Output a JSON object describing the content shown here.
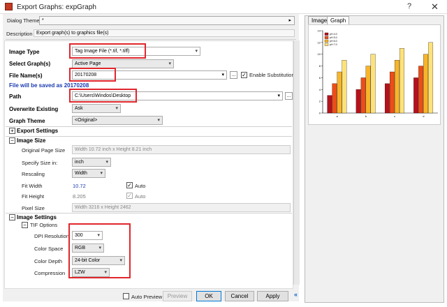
{
  "window": {
    "title": "Export Graphs: expGraph",
    "help": "?",
    "close": "✕"
  },
  "dialog_theme": {
    "label": "Dialog Theme",
    "value": "*",
    "arrow": "▸"
  },
  "description": {
    "label": "Description",
    "value": "Export graph(s) to graphics file(s)"
  },
  "form": {
    "image_type": {
      "label": "Image Type",
      "value": "Tag Image File (*.tif, *.tiff)"
    },
    "select_graphs": {
      "label": "Select Graph(s)",
      "value": "Active Page"
    },
    "file_name": {
      "label": "File Name(s)",
      "value": "20170208",
      "button": "...",
      "enable_substitution": "Enable Substitution",
      "enable_substitution_checked": true
    },
    "saved_as": "File will be saved as 20170208",
    "path": {
      "label": "Path",
      "value": "C:\\Users\\Windos\\Desktop",
      "button": "..."
    },
    "overwrite": {
      "label": "Overwrite Existing",
      "value": "Ask"
    },
    "graph_theme": {
      "label": "Graph Theme",
      "value": "<Original>"
    },
    "export_settings": {
      "label": "Export Settings",
      "toggle": "+"
    },
    "image_size": {
      "label": "Image Size",
      "toggle": "−",
      "original_page_size": {
        "label": "Original Page Size",
        "value": "Width 10.72 inch x Height 8.21 inch"
      },
      "specify_size_in": {
        "label": "Specify Size in:",
        "value": "inch"
      },
      "rescaling": {
        "label": "Rescaling",
        "value": "Width"
      },
      "fit_width": {
        "label": "Fit Width",
        "value": "10.72",
        "auto": "Auto",
        "auto_checked": true
      },
      "fit_height": {
        "label": "Fit Height",
        "value": "8.205",
        "auto": "Auto",
        "auto_checked": true
      },
      "pixel_size": {
        "label": "Pixel Size",
        "value": "Width 3216 x Height 2462"
      }
    },
    "image_settings": {
      "label": "Image Settings",
      "toggle": "−",
      "tif_options": {
        "label": "TIF Options",
        "toggle": "−"
      },
      "dpi_resolution": {
        "label": "DPI Resolution",
        "value": "300"
      },
      "color_space": {
        "label": "Color Space",
        "value": "RGB"
      },
      "color_depth": {
        "label": "Color Depth",
        "value": "24-bit Color"
      },
      "compression": {
        "label": "Compression",
        "value": "LZW"
      }
    }
  },
  "buttons": {
    "auto_preview": "Auto Preview",
    "preview": "Preview",
    "ok": "OK",
    "cancel": "Cancel",
    "apply": "Apply",
    "collapse": "«"
  },
  "tabs": {
    "image": "Image",
    "graph": "Graph"
  },
  "chart_data": {
    "type": "bar",
    "categories": [
      "a",
      "b",
      "c",
      "d"
    ],
    "series": [
      {
        "name": "pH 4.0",
        "values": [
          3,
          4,
          5,
          6
        ],
        "color": "#b5121b"
      },
      {
        "name": "pH 5.0",
        "values": [
          5,
          6,
          7,
          8
        ],
        "color": "#ee4d17"
      },
      {
        "name": "pH 6.0",
        "values": [
          7,
          8,
          9,
          10
        ],
        "color": "#f8b52a"
      },
      {
        "name": "pH 7.0",
        "values": [
          9,
          10,
          11,
          12
        ],
        "color": "#fde27a"
      }
    ],
    "ylim": [
      0,
      14
    ],
    "yticks": [
      "0",
      "2",
      "4",
      "6",
      "8",
      "10",
      "12",
      "14"
    ],
    "legend": "top-left"
  }
}
